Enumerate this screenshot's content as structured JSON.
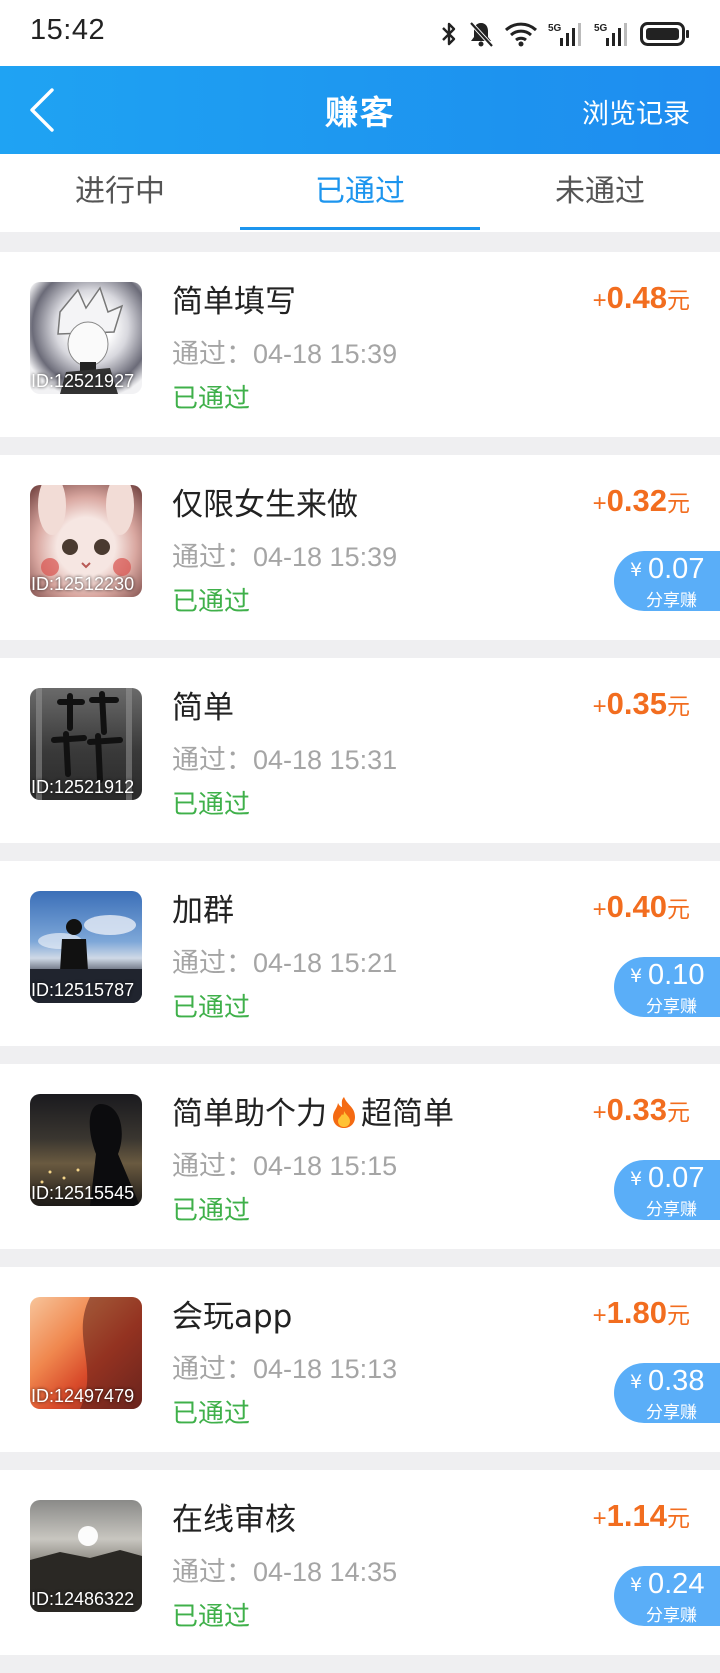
{
  "status_bar": {
    "time": "15:42",
    "signal1": "5G",
    "signal2": "5G"
  },
  "header": {
    "title": "赚客",
    "history": "浏览记录"
  },
  "tabs": [
    {
      "label": "进行中",
      "active": false
    },
    {
      "label": "已通过",
      "active": true
    },
    {
      "label": "未通过",
      "active": false
    }
  ],
  "items": [
    {
      "name": "简单填写",
      "time": "通过：04-18 15:39",
      "status": "已通过",
      "id": "ID:12521927",
      "plus": "+",
      "amount": "0.48",
      "unit": "元",
      "share_yen": "¥",
      "share_value": "",
      "share_label": ""
    },
    {
      "name": "仅限女生来做",
      "time": "通过：04-18 15:39",
      "status": "已通过",
      "id": "ID:12512230",
      "plus": "+",
      "amount": "0.32",
      "unit": "元",
      "share_yen": "¥",
      "share_value": "0.07",
      "share_label": "分享赚"
    },
    {
      "name": "简单",
      "time": "通过：04-18 15:31",
      "status": "已通过",
      "id": "ID:12521912",
      "plus": "+",
      "amount": "0.35",
      "unit": "元",
      "share_yen": "¥",
      "share_value": "",
      "share_label": ""
    },
    {
      "name": "加群",
      "time": "通过：04-18 15:21",
      "status": "已通过",
      "id": "ID:12515787",
      "plus": "+",
      "amount": "0.40",
      "unit": "元",
      "share_yen": "¥",
      "share_value": "0.10",
      "share_label": "分享赚"
    },
    {
      "name_a": "简单助个力",
      "name_b": "超简单",
      "time": "通过：04-18 15:15",
      "status": "已通过",
      "id": "ID:12515545",
      "plus": "+",
      "amount": "0.33",
      "unit": "元",
      "share_yen": "¥",
      "share_value": "0.07",
      "share_label": "分享赚"
    },
    {
      "name": "会玩app",
      "time": "通过：04-18 15:13",
      "status": "已通过",
      "id": "ID:12497479",
      "plus": "+",
      "amount": "1.80",
      "unit": "元",
      "share_yen": "¥",
      "share_value": "0.38",
      "share_label": "分享赚"
    },
    {
      "name": "在线审核",
      "time": "通过：04-18 14:35",
      "status": "已通过",
      "id": "ID:12486322",
      "plus": "+",
      "amount": "1.14",
      "unit": "元",
      "share_yen": "¥",
      "share_value": "0.24",
      "share_label": "分享赚"
    }
  ],
  "colors": {
    "header": "#1d93ef",
    "accent": "#1d95ee",
    "reward": "#f26d1f",
    "status": "#3fb04a",
    "share": "#5aaef8"
  }
}
